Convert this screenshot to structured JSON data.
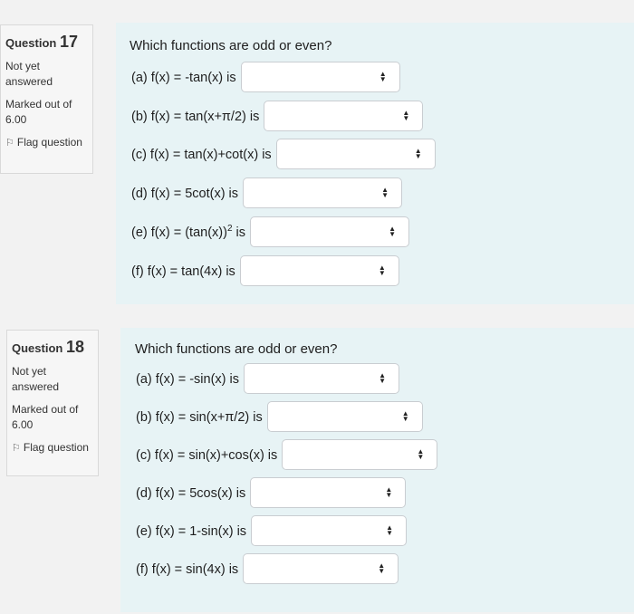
{
  "q17": {
    "label": "Question",
    "number": "17",
    "status": "Not yet answered",
    "marks": "Marked out of 6.00",
    "flag": "Flag question",
    "prompt": "Which functions are odd or even?",
    "items": [
      {
        "pre": "(a) f(x) = -tan(x) is",
        "sup": "",
        "post": "",
        "value": ""
      },
      {
        "pre": "(b) f(x) = tan(x+π/2) is",
        "sup": "",
        "post": "",
        "value": ""
      },
      {
        "pre": "(c) f(x) = tan(x)+cot(x) is",
        "sup": "",
        "post": "",
        "value": ""
      },
      {
        "pre": "(d) f(x) = 5cot(x) is",
        "sup": "",
        "post": "",
        "value": ""
      },
      {
        "pre": "(e) f(x) = (tan(x))",
        "sup": "2",
        "post": " is",
        "value": ""
      },
      {
        "pre": "(f) f(x) = tan(4x) is",
        "sup": "",
        "post": "",
        "value": ""
      }
    ]
  },
  "q18": {
    "label": "Question",
    "number": "18",
    "status": "Not yet answered",
    "marks": "Marked out of 6.00",
    "flag": "Flag question",
    "prompt": "Which functions are odd or even?",
    "items": [
      {
        "pre": "(a) f(x) = -sin(x) is",
        "sup": "",
        "post": "",
        "value": ""
      },
      {
        "pre": "(b) f(x) = sin(x+π/2) is",
        "sup": "",
        "post": "",
        "value": ""
      },
      {
        "pre": "(c) f(x) = sin(x)+cos(x) is",
        "sup": "",
        "post": "",
        "value": ""
      },
      {
        "pre": "(d) f(x) = 5cos(x) is",
        "sup": "",
        "post": "",
        "value": ""
      },
      {
        "pre": "(e) f(x) = 1-sin(x) is",
        "sup": "",
        "post": "",
        "value": ""
      },
      {
        "pre": "(f) f(x) = sin(4x) is",
        "sup": "",
        "post": "",
        "value": ""
      }
    ]
  }
}
